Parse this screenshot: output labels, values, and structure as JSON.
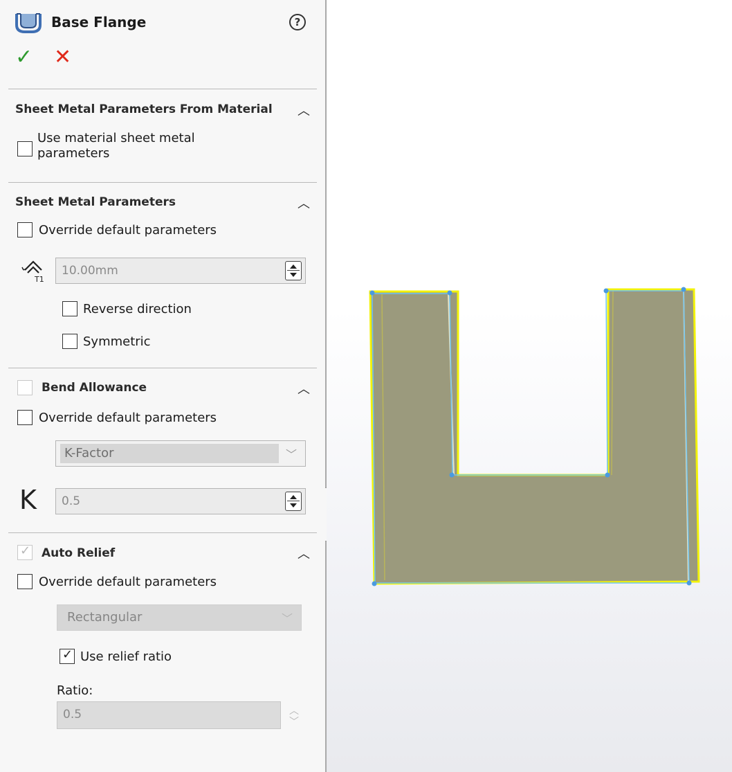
{
  "panel": {
    "title": "Base Flange",
    "help_glyph": "?",
    "ok_glyph": "✓",
    "cancel_glyph": "✕"
  },
  "sections": {
    "material": {
      "title": "Sheet Metal Parameters From Material",
      "checkbox_label_line1": "Use material sheet metal",
      "checkbox_label_line2": "parameters",
      "checked": false
    },
    "sheet_metal": {
      "title": "Sheet Metal Parameters",
      "override_label": "Override default parameters",
      "thickness_value": "10.00mm",
      "thickness_icon": "sheet-thickness-icon",
      "reverse_label": "Reverse direction",
      "symmetric_label": "Symmetric"
    },
    "bend_allowance": {
      "title": "Bend Allowance",
      "override_label": "Override default parameters",
      "type_value": "K-Factor",
      "k_symbol": "K",
      "k_value": "0.5"
    },
    "auto_relief": {
      "title": "Auto Relief",
      "override_label": "Override default parameters",
      "relief_type": "Rectangular",
      "use_ratio_label": "Use relief ratio",
      "use_ratio_checked": true,
      "ratio_label": "Ratio:",
      "ratio_value": "0.5"
    }
  },
  "colors": {
    "accept": "#2e9a2e",
    "cancel": "#e02a1b",
    "part_fill": "#9b9a7d",
    "part_edge": "#f2f20a",
    "sketch_line": "#6ec3f0"
  }
}
